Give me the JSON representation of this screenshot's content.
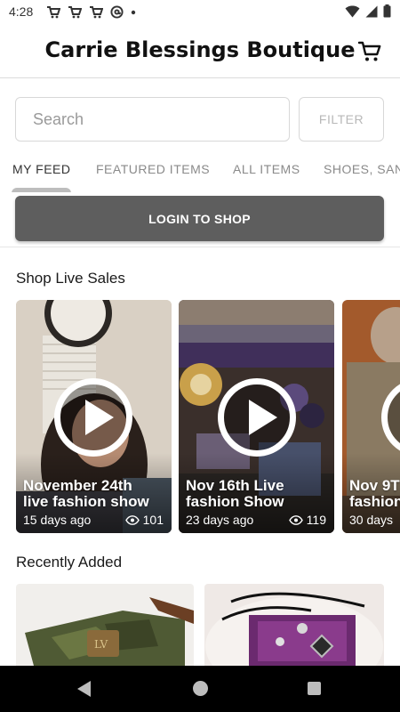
{
  "status_bar": {
    "time": "4:28",
    "left_icons": [
      "cart-notification-icon",
      "cart-notification-icon",
      "cart-notification-icon",
      "at-sign-icon",
      "dot-icon"
    ],
    "right_icons": [
      "wifi-icon",
      "cell-signal-icon",
      "battery-icon"
    ]
  },
  "header": {
    "title": "Carrie Blessings Boutique",
    "cart_icon": "shopping-cart-icon"
  },
  "search": {
    "placeholder": "Search",
    "filter_label": "FILTER"
  },
  "tabs": [
    {
      "label": "MY FEED",
      "active": true
    },
    {
      "label": "FEATURED ITEMS",
      "active": false
    },
    {
      "label": "ALL ITEMS",
      "active": false
    },
    {
      "label": "SHOES, SAN",
      "active": false
    }
  ],
  "login": {
    "label": "LOGIN TO SHOP"
  },
  "live_sales": {
    "title": "Shop Live Sales",
    "items": [
      {
        "title": "November 24th\nlive fashion show",
        "age": "15 days ago",
        "views": "101",
        "play_icon": "play-icon",
        "views_icon": "eye-icon"
      },
      {
        "title": "Nov 16th Live\nfashion Show",
        "age": "23 days ago",
        "views": "119",
        "play_icon": "play-icon",
        "views_icon": "eye-icon"
      },
      {
        "title": "Nov 9T\nfashion",
        "age": "30 days",
        "views": "",
        "play_icon": "play-icon",
        "views_icon": ""
      }
    ]
  },
  "recently_added": {
    "title": "Recently Added"
  },
  "colors": {
    "login_button": "#5e5e5e",
    "nav_bar": "#000000",
    "text_primary": "#111111",
    "tab_inactive": "#8a8a8a"
  }
}
